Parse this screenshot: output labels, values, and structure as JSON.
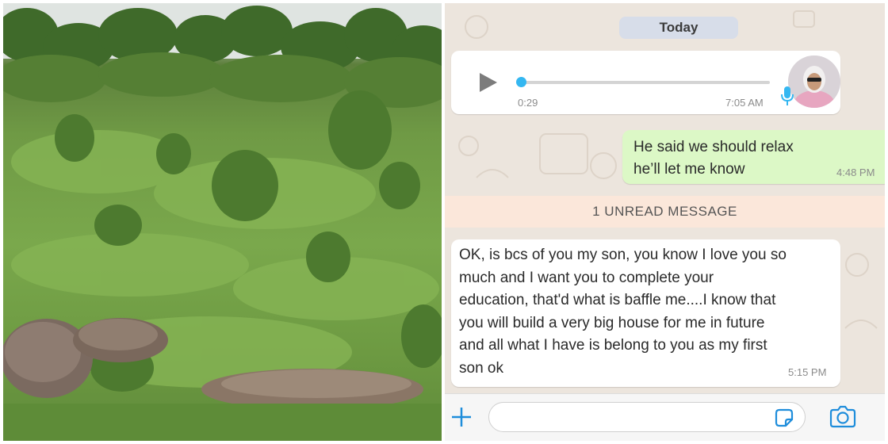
{
  "chat": {
    "date_chip": "Today",
    "voice_message": {
      "duration": "0:29",
      "time": "7:05 AM",
      "progress": 0.0,
      "icons": [
        "play-icon",
        "microphone-icon"
      ]
    },
    "outgoing_message": {
      "text": "He said we should relax\nhe’ll let me know",
      "time": "4:48 PM"
    },
    "unread_banner": "1 UNREAD MESSAGE",
    "incoming_message": {
      "text": "OK, is bcs of you my son, you know I love you so\nmuch and I want you to complete your\neducation, that'd what is baffle me....I know that\nyou will build a very big house for me in future\nand all what I have is belong to you as my first\nson ok",
      "time": "5:15 PM"
    },
    "input_bar": {
      "placeholder": "",
      "icons": [
        "plus-icon",
        "sticker-icon",
        "camera-icon"
      ]
    }
  },
  "colors": {
    "chat_background": "#ece5dd",
    "outgoing_bubble": "#dcf8c6",
    "incoming_bubble": "#ffffff",
    "unread_banner": "#fbe7da",
    "accent": "#1e8ddb",
    "progress_knob": "#34b7f1"
  }
}
